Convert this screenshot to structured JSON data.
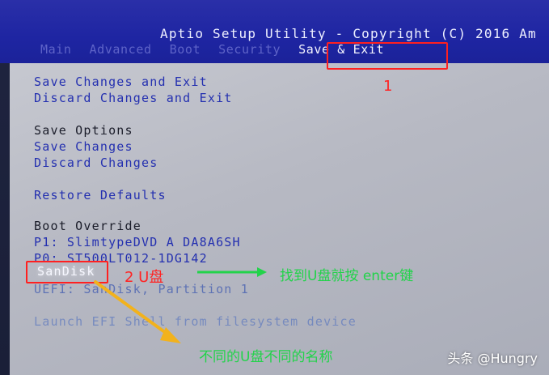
{
  "bios": {
    "title": "Aptio Setup Utility - Copyright (C) 2016 Am",
    "tabs": [
      {
        "label": "Main"
      },
      {
        "label": "Advanced"
      },
      {
        "label": "Boot"
      },
      {
        "label": "Security"
      },
      {
        "label": "Save & Exit"
      }
    ],
    "items": {
      "save_changes_exit": "Save Changes and Exit",
      "discard_changes_exit": "Discard Changes and Exit",
      "save_options": "Save Options",
      "save_changes": "Save Changes",
      "discard_changes": "Discard Changes",
      "restore_defaults": "Restore Defaults",
      "boot_override": "Boot Override",
      "p1": "P1: SlimtypeDVD A  DA8A6SH",
      "p0": "P0: ST500LT012-1DG142",
      "sandisk": "SanDisk",
      "uefi_sandisk": "UEFI: SanDisk, Partition 1",
      "launch_efi": "Launch EFI Shell from filesystem device"
    }
  },
  "annotations": {
    "step1": "1",
    "step2": "2 U盘",
    "find_usb": "找到U盘就按 enter键",
    "different_names": "不同的U盘不同的名称"
  },
  "watermark": "头条 @Hungry",
  "colors": {
    "bios_blue": "#1e25a2",
    "panel_gray": "#b7b9c3",
    "link_blue": "#2430b0",
    "annotation_red": "#ff2020",
    "annotation_green": "#22d34a",
    "arrow_yellow": "#f2b21c"
  }
}
